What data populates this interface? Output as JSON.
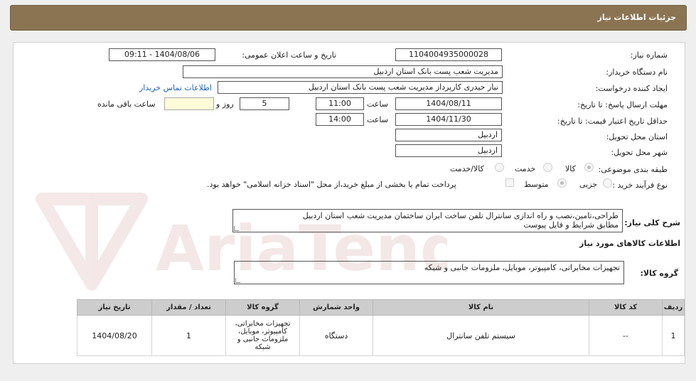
{
  "header": {
    "title": "جزئیات اطلاعات نیاز"
  },
  "watermark": {
    "text": "AriaTender.neT"
  },
  "fields": {
    "need_number_label": "شماره نیاز:",
    "need_number": "1104004935000028",
    "announce_label": "تاریخ و ساعت اعلان عمومی:",
    "announce_value": "1404/08/06 - 09:11",
    "buyer_org_label": "نام دستگاه خریدار:",
    "buyer_org": "مدیریت شعب پست بانک استان اردبیل",
    "requester_label": "ایجاد کننده درخواست:",
    "requester": "نیاز حیدری کارپرداز مدیریت شعب پست بانک استان اردبیل",
    "contact_link": "اطلاعات تماس خریدار",
    "reply_deadline_label": "مهلت ارسال پاسخ: تا تاریخ:",
    "reply_date": "1404/08/11",
    "hour_label": "ساعت",
    "reply_time": "11:00",
    "days_value": "5",
    "days_label": "روز و",
    "remaining_label": "ساعت باقی مانده",
    "remaining_value": "",
    "validity_label": "حداقل تاریخ اعتبار قیمت: تا تاریخ:",
    "validity_date": "1404/11/30",
    "validity_hour_label": "ساعت",
    "validity_time": "14:00",
    "province_label": "استان محل تحویل:",
    "province": "اردبیل",
    "city_label": "شهر محل تحویل:",
    "city": "اردبیل",
    "category_label": "طبقه بندی موضوعی:",
    "category_options": [
      "کالا",
      "خدمت",
      "کالا/خدمت"
    ],
    "process_label": "نوع فرآیند خرید :",
    "process_options": [
      "جزیی",
      "متوسط"
    ],
    "payment_note": "پرداخت تمام یا بخشی از مبلغ خرید،از محل \"اسناد خزانه اسلامی\" خواهد بود.",
    "description_label": "شرح کلی نیاز:",
    "description_line1": "طراحی،تامین،نصب و راه اندازی سانترال تلفن ساخت ایران ساختمان مدیریت شعب استان اردبیل",
    "description_line2": "مطابق شرایط و فایل پیوست",
    "goods_info_title": "اطلاعات کالاهای مورد نیاز",
    "goods_group_label": "گروه کالا:",
    "goods_group": "تجهیزات مخابراتی، کامپیوتر، موبایل، ملزومات جانبی و شبکه"
  },
  "table": {
    "headers": [
      "ردیف",
      "کد کالا",
      "نام کالا",
      "واحد شمارش",
      "گروه کالا",
      "تعداد / مقدار",
      "تاریخ نیاز"
    ],
    "rows": [
      [
        "1",
        "--",
        "سیستم تلفن سانترال",
        "دستگاه",
        "تجهیزات مخابراتی، کامپیوتر، موبایل، ملزومات جانبی و شبکه",
        "1",
        "1404/08/20"
      ]
    ]
  }
}
